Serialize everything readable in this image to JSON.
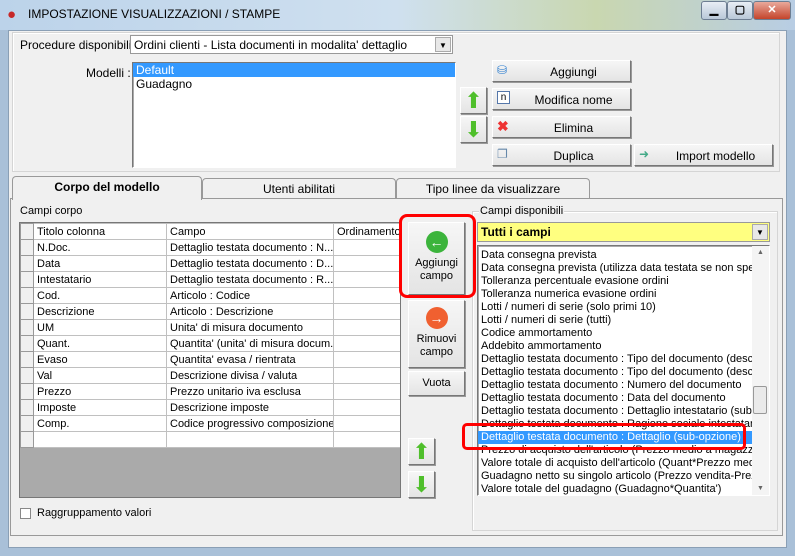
{
  "window": {
    "title": "IMPOSTAZIONE VISUALIZZAZIONI / STAMPE",
    "minimize": "▁",
    "maximize": "▢",
    "close": "✕"
  },
  "top": {
    "procedure_label": "Procedure disponibili :",
    "procedure_value": "Ordini clienti - Lista documenti in modalita' dettaglio",
    "modelli_label": "Modelli :",
    "modelli": [
      "Default",
      "Guadagno"
    ],
    "selected_modello": "Default",
    "buttons": {
      "add": "Aggiungi",
      "rename": "Modifica nome",
      "delete": "Elimina",
      "duplicate": "Duplica",
      "import": "Import modello"
    }
  },
  "tabs": [
    {
      "label": "Corpo del modello",
      "active": true
    },
    {
      "label": "Utenti abilitati"
    },
    {
      "label": "Tipo linee da visualizzare"
    }
  ],
  "body": {
    "campi_corpo_label": "Campi corpo",
    "columns": [
      "Titolo colonna",
      "Campo",
      "Ordinamento"
    ],
    "rows": [
      [
        "N.Doc.",
        "Dettaglio testata documento : N...",
        ""
      ],
      [
        "Data",
        "Dettaglio testata documento : D...",
        ""
      ],
      [
        "Intestatario",
        "Dettaglio testata documento : R...",
        ""
      ],
      [
        "Cod.",
        "Articolo : Codice",
        ""
      ],
      [
        "Descrizione",
        "Articolo : Descrizione",
        ""
      ],
      [
        "UM",
        "Unita' di misura documento",
        ""
      ],
      [
        "Quant.",
        "Quantita' (unita' di misura docum...",
        ""
      ],
      [
        "Evaso",
        "Quantita' evasa / rientrata",
        ""
      ],
      [
        "Val",
        "Descrizione divisa / valuta",
        ""
      ],
      [
        "Prezzo",
        "Prezzo unitario iva esclusa",
        ""
      ],
      [
        "Imposte",
        "Descrizione imposte",
        ""
      ],
      [
        "Comp.",
        "Codice progressivo composizione",
        ""
      ],
      [
        "",
        "",
        ""
      ]
    ],
    "add_field": "Aggiungi campo",
    "remove_field": "Rimuovi campo",
    "empty": "Vuota",
    "grouping_label": "Raggruppamento valori",
    "grouping_checked": false,
    "available_label": "Campi disponibili",
    "filter_value": "Tutti i campi",
    "available": [
      "Data consegna prevista",
      "Data consegna prevista (utilizza data testata se non speci",
      "Tolleranza percentuale evasione ordini",
      "Tolleranza numerica evasione ordini",
      "Lotti / numeri di serie (solo primi 10)",
      "Lotti / numeri di serie (tutti)",
      "Codice ammortamento",
      "Addebito ammortamento",
      "Dettaglio testata documento : Tipo del documento (descri",
      "Dettaglio testata documento : Tipo del documento (descri",
      "Dettaglio testata documento : Numero del documento",
      "Dettaglio testata documento : Data del documento",
      "Dettaglio testata documento : Dettaglio intestatario (sub-op",
      "Dettaglio testata documento : Ragione sociale intestatario",
      "Dettaglio testata documento : Dettaglio (sub-opzione)",
      "Prezzo di acquisto dell'articolo (Prezzo medio a magazzino",
      "Valore totale di acquisto dell'articolo (Quant*Prezzo medio)",
      "Guadagno netto su singolo articolo (Prezzo vendita-Prezzo",
      "Valore totale del guadagno (Guadagno*Quantita')"
    ],
    "selected_available_index": 14
  },
  "colors": {
    "selection": "#3399ff",
    "filter_bg": "#ffff80",
    "highlight_outline": "#ff0000"
  }
}
